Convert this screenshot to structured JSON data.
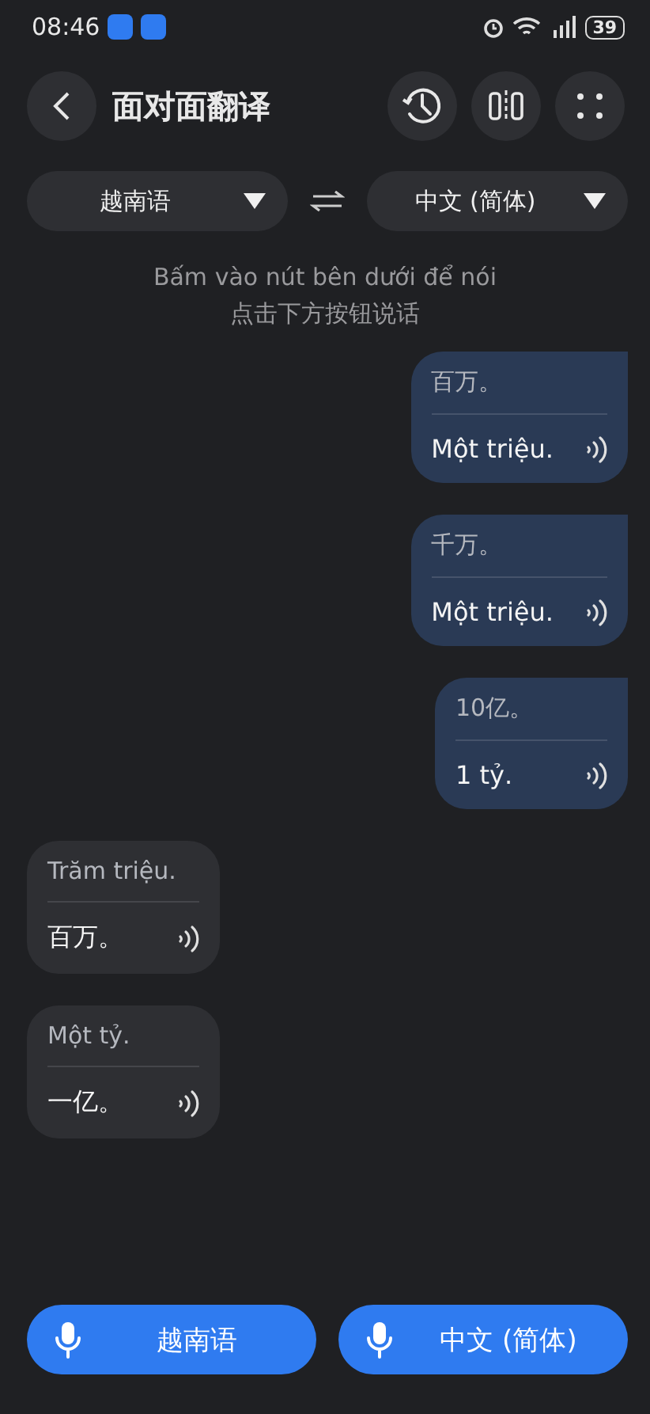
{
  "status_bar": {
    "time": "08:46",
    "battery": "39"
  },
  "header": {
    "title": "面对面翻译"
  },
  "languages": {
    "source": "越南语",
    "target": "中文 (简体)"
  },
  "hint": [
    "Bấm vào nút bên dưới để nói",
    "点击下方按钮说话"
  ],
  "messages": [
    {
      "kind": "right",
      "original": "百万。",
      "translation": "Một triệu."
    },
    {
      "kind": "right",
      "original": "千万。",
      "translation": "Một triệu."
    },
    {
      "kind": "right",
      "original": "10亿。",
      "translation": "1 tỷ."
    },
    {
      "kind": "left",
      "original": "Trăm triệu.",
      "translation": "百万。"
    },
    {
      "kind": "left",
      "original": "Một tỷ.",
      "translation": "一亿。"
    }
  ],
  "mic_buttons": [
    "越南语",
    "中文 (简体)"
  ]
}
